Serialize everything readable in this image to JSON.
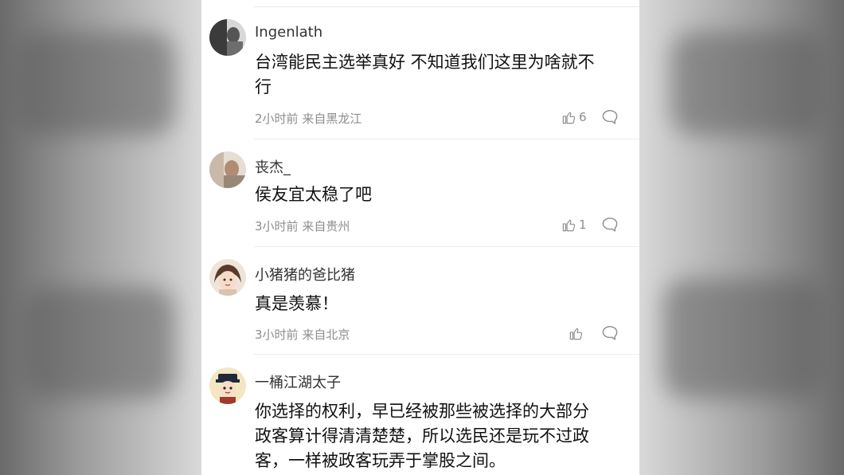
{
  "comments": [
    {
      "username": "Ingenlath",
      "content": "台湾能民主选举真好 不知道我们这里为啥就不\n行",
      "time": "2小时前",
      "location": "来自黑龙江",
      "likes": "6",
      "avatar_icon": "avatar-photo-dark"
    },
    {
      "username": "丧杰_",
      "content": "侯友宜太稳了吧",
      "time": "3小时前",
      "location": "来自贵州",
      "likes": "1",
      "avatar_icon": "avatar-photo-light"
    },
    {
      "username": "小猪猪的爸比猪",
      "content": "真是羡慕！",
      "time": "3小时前",
      "location": "来自北京",
      "likes": "",
      "avatar_icon": "avatar-cartoon-girl"
    },
    {
      "username": "一桶江湖太子",
      "content": "你选择的权利，早已经被那些被选择的大部分\n政客算计得清清楚楚，所以选民还是玩不过政\n客，一样被政客玩弄于掌股之间。",
      "time": "",
      "location": "",
      "likes": "",
      "avatar_icon": "avatar-cartoon-official"
    }
  ],
  "icons": {
    "like": "thumbs-up-icon",
    "reply": "comment-bubble-icon"
  },
  "colors": {
    "text": "#111111",
    "username": "#333333",
    "meta": "#8e8e8e",
    "divider": "#ececec",
    "panel": "#ffffff"
  }
}
